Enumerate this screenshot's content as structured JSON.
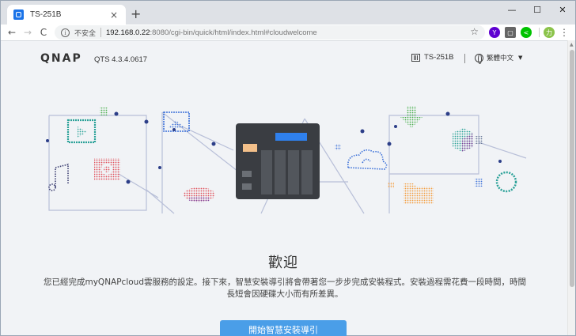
{
  "browser": {
    "tab": {
      "title": "TS-251B",
      "close": "×"
    },
    "new_tab": "+",
    "window_controls": {
      "minimize": "—",
      "maximize": "☐",
      "close": "✕"
    },
    "nav": {
      "back": "←",
      "forward": "→",
      "reload": "C"
    },
    "omnibox": {
      "info": "i",
      "security_label": "不安全",
      "url_host": "192.168.0.22",
      "url_rest": ":8080/cgi-bin/quick/html/index.html#cloudwelcome",
      "star": "☆"
    },
    "extensions": [
      {
        "name": "yahoo-extension-icon",
        "glyph": "Y",
        "color": "#5f01d1"
      },
      {
        "name": "extension-square-icon",
        "glyph": "▢",
        "color": "#666666"
      },
      {
        "name": "share-extension-icon",
        "glyph": "<",
        "color": "#00c300"
      },
      {
        "name": "profile-avatar-icon",
        "glyph": "力",
        "color": "#8bc34a"
      }
    ],
    "menu": "⋮"
  },
  "header": {
    "logo": "QNAP",
    "version": "QTS 4.3.4.0617",
    "device_name": "TS-251B",
    "language": "繁體中文",
    "caret": "▼"
  },
  "main": {
    "title": "歡迎",
    "description": "您已經完成myQNAPcloud雲服務的設定。接下來，智慧安裝導引將會帶著您一步步完成安裝程式。安裝過程需花費一段時間，時間長短會因硬碟大小而有所差異。",
    "start_button": "開始智慧安裝導引"
  },
  "colors": {
    "accent": "#4a9ee8",
    "page_bg": "#f1f3f6",
    "illustration_line": "#b8bfd8",
    "nas_body": "#3a3d42",
    "nas_display": "#2f80ed",
    "teal": "#2aa198",
    "red": "#e0505a",
    "orange": "#f39c3c",
    "purple": "#7d3c98",
    "green": "#4caf50"
  }
}
